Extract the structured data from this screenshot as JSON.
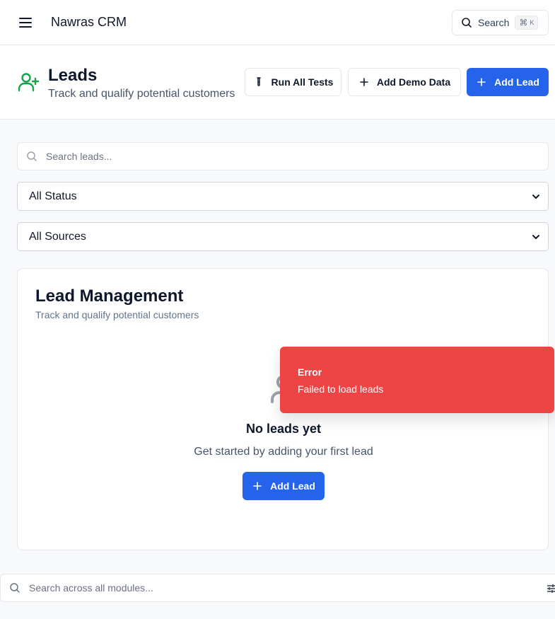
{
  "app": {
    "title": "Nawras CRM"
  },
  "topbar": {
    "search_label": "Search",
    "shortcut_symbol": "⌘",
    "shortcut_key": "K"
  },
  "header": {
    "title": "Leads",
    "subtitle": "Track and qualify potential customers",
    "run_tests_label": "Run All Tests",
    "add_demo_label": "Add Demo Data",
    "add_lead_label": "Add Lead"
  },
  "filters": {
    "search_placeholder": "Search leads...",
    "status_value": "All Status",
    "sources_value": "All Sources"
  },
  "card": {
    "title": "Lead Management",
    "subtitle": "Track and qualify potential customers",
    "empty_title": "No leads yet",
    "empty_description": "Get started by adding your first lead",
    "add_lead_label": "Add Lead"
  },
  "toast": {
    "title": "Error",
    "message": "Failed to load leads"
  },
  "global_search": {
    "placeholder": "Search across all modules..."
  },
  "colors": {
    "primary": "#2563eb",
    "success_icon": "#16a34a",
    "error": "#ef4444"
  },
  "icons": [
    "menu-icon",
    "search-icon",
    "user-plus-icon",
    "test-tube-icon",
    "plus-icon",
    "chevron-down-icon",
    "user-icon",
    "sliders-icon"
  ]
}
